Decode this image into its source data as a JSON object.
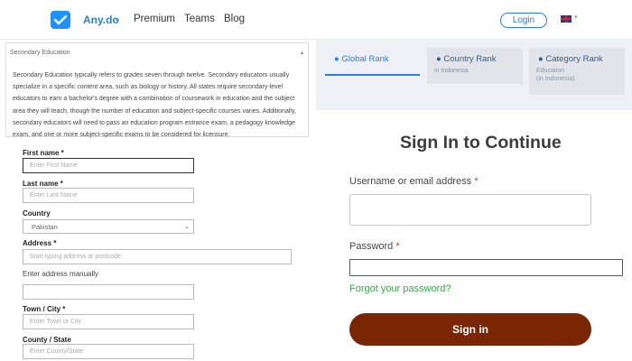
{
  "nav": {
    "brand": "Any.do",
    "brand_caret": "⌄",
    "links": [
      "Premium",
      "Teams",
      "Blog"
    ],
    "login": "Login",
    "lang": "▾",
    "accent": "#2a7de1"
  },
  "info": {
    "title": "Secondary Education",
    "collapse": "▴",
    "body": "Secondary Education typically refers to grades seven through twelve. Secondary educators usually specialize in a specific content area, such as biology or history. All states require secondary-level educators to earn a bachelor's degree with a combination of coursework in education and the subject area they will teach, though the number of education and subject-specific courses varies. Additionally, secondary educators will need to pass an education program entrance exam, a pedagogy knowledge exam, and one or more subject-specific exams to be considered for licensure."
  },
  "form": {
    "first_name_label": "First name *",
    "first_name_placeholder": "Enter First Name",
    "last_name_label": "Last name *",
    "last_name_placeholder": "Enter Last Name",
    "country_label": "Country",
    "country_value": "Pakistan",
    "address_label": "Address *",
    "address_placeholder": "Start typing address or postcode",
    "manual_label": "Enter address manually",
    "town_label": "Town / City *",
    "town_placeholder": "Enter Town or City",
    "county_label": "County / State",
    "county_placeholder": "Enter County/State"
  },
  "rank_tabs": [
    {
      "label": "Global Rank",
      "sub": ""
    },
    {
      "label": "Country Rank",
      "sub": "in Indonesia"
    },
    {
      "label": "Category Rank",
      "sub": "Education",
      "sub2": "(in Indonesia)"
    }
  ],
  "signin": {
    "title": "Sign In to Continue",
    "username_label": "Username or email address",
    "password_label": "Password",
    "required_mark": "*",
    "forgot": "Forgot your password?",
    "button": "Sign in",
    "button_color": "#7a2504",
    "link_color": "#39a845"
  }
}
